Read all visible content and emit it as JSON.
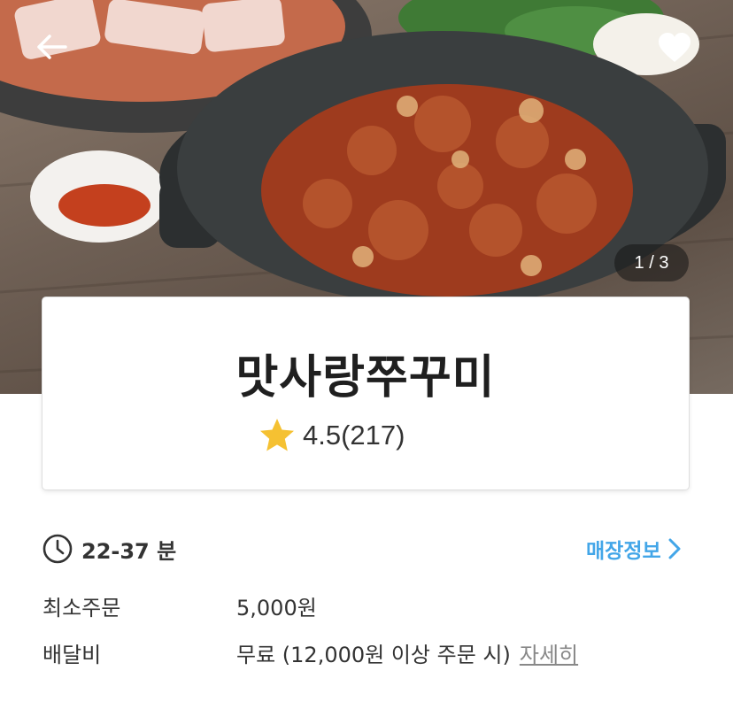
{
  "hero": {
    "image_counter": "1 / 3"
  },
  "store": {
    "name": "맛사랑쭈꾸미",
    "rating": "4.5(217)"
  },
  "delivery": {
    "time": "22-37 분",
    "store_info_label": "매장정보"
  },
  "info": {
    "min_order_label": "최소주문",
    "min_order_value": "5,000원",
    "delivery_fee_label": "배달비",
    "delivery_fee_value": "무료 (12,000원 이상 주문 시)",
    "detail_link": "자세히"
  },
  "colors": {
    "accent_blue": "#43a6e8",
    "star": "#f5c132"
  },
  "icons": [
    "back-arrow-icon",
    "heart-icon",
    "star-icon",
    "clock-icon",
    "chevron-right-icon"
  ]
}
